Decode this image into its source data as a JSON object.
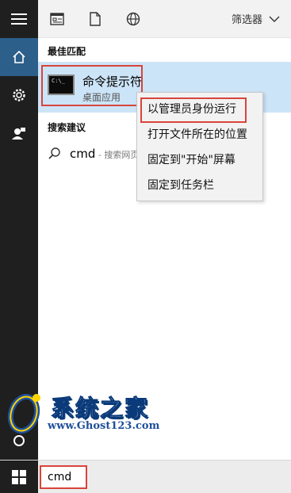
{
  "toolbar": {
    "filter_label": "筛选器",
    "icons": [
      "document-list-icon",
      "file-icon",
      "globe-icon",
      "chevron-down-icon"
    ]
  },
  "rail": {
    "items": [
      {
        "icon": "hamburger-menu-icon"
      },
      {
        "icon": "home-icon",
        "active": true
      },
      {
        "icon": "gear-icon"
      },
      {
        "icon": "person-feedback-icon"
      },
      {
        "icon": "cortana-circle-icon"
      }
    ]
  },
  "best_match": {
    "section_title": "最佳匹配",
    "item_title": "命令提示符",
    "item_subtitle": "桌面应用",
    "icon_text": "C:\\_"
  },
  "suggestions": {
    "section_title": "搜索建议",
    "items": [
      {
        "text": "cmd",
        "hint": " - 搜索网页"
      }
    ]
  },
  "context_menu": {
    "items": [
      {
        "label": "以管理员身份运行",
        "highlighted": true
      },
      {
        "label": "打开文件所在的位置"
      },
      {
        "label": "固定到\"开始\"屏幕"
      },
      {
        "label": "固定到任务栏"
      }
    ]
  },
  "taskbar": {
    "search_value": "cmd"
  },
  "watermark": {
    "title": "系统之家",
    "url": "www.Ghost123.com"
  },
  "colors": {
    "accent": "#2c5f8a",
    "highlight_box": "#d9443c",
    "selected_row": "#cce4f7"
  }
}
